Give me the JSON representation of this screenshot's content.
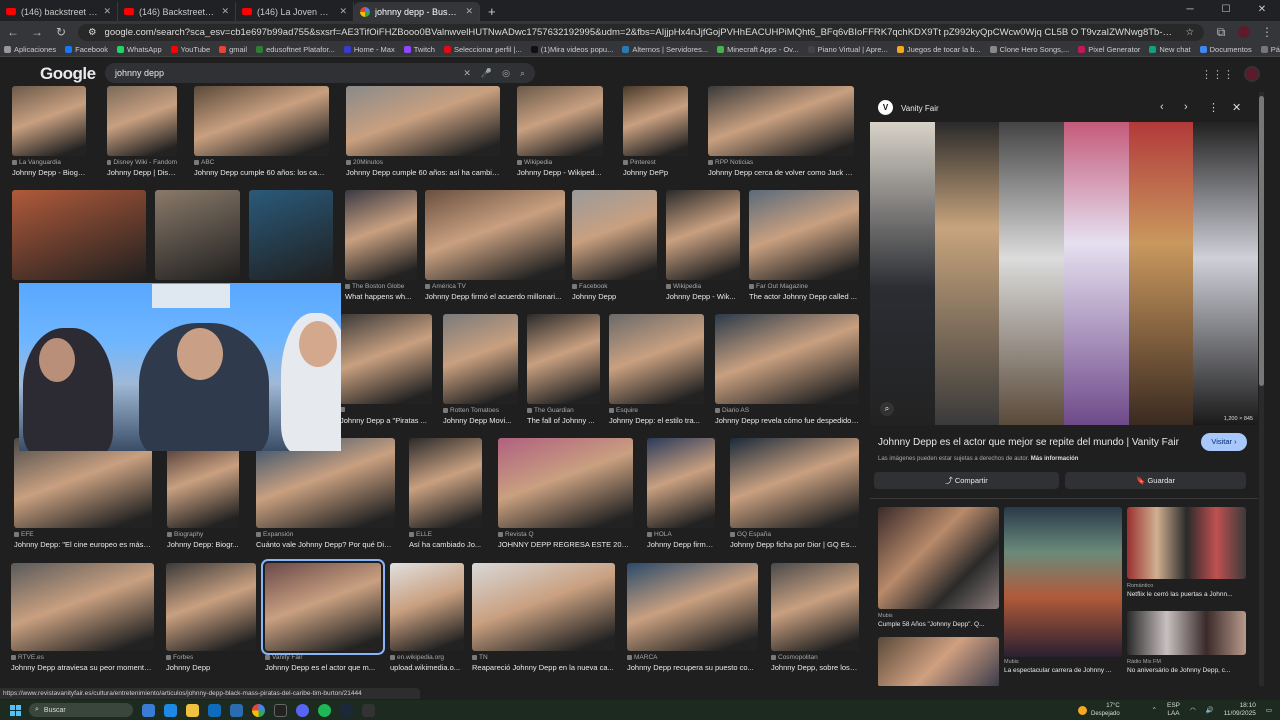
{
  "browser": {
    "tabs": [
      {
        "title": "(146) backstreet boys - YouTube",
        "icon": "youtube-icon",
        "active": false
      },
      {
        "title": "(146) Backstreet Boys - Everybody",
        "icon": "youtube-icon",
        "active": false
      },
      {
        "title": "(146) La Joven Sensacion - Tic T",
        "icon": "youtube-icon",
        "active": false
      },
      {
        "title": "johnny depp - Buscar con Google",
        "icon": "google-icon",
        "active": true
      }
    ],
    "url": "google.com/search?sca_esv=cb1e697b99ad755&sxsrf=AE3TifOiFHZBooo0BValnwvelHUTNwADwc1757632192995&udm=2&fbs=AIjjpHx4nJjfGojPVHhEACUHPiMQht6_BFq6vBIoFFRK7qchKDX9Tt pZ992kyQpCWcw0Wjq CL5B O T9vzaIZWNwg8Tb-QmvZCiEHsytz1lCFiXD45TFwNx93at7LArk6EoetyQxB0XkUZWpIsL6OVYumoXTG9sQsig11Z5fTjkFXeiu6veBlnj",
    "bookmarks": [
      "Aplicaciones",
      "Facebook",
      "WhatsApp",
      "YouTube",
      "gmail",
      "edusoftnet Platafor...",
      "Home - Max",
      "Twitch",
      "Seleccionar perfil |...",
      "(1)Mira videos popu...",
      "Alternos | Servidores...",
      "Minecraft Apps - Ov...",
      "Piano Virtual | Apre...",
      "Juegos de tocar la b...",
      "Clone Hero Songs,...",
      "Pixel Generator",
      "New chat",
      "Documentos",
      "Página de inicio -..."
    ]
  },
  "google": {
    "logo": "Google",
    "query": "johnny depp"
  },
  "results": [
    {
      "src": "La Vanguardia",
      "title": "Johnny Depp - Biogra..."
    },
    {
      "src": "Disney Wiki - Fandom",
      "title": "Johnny Depp | Disne..."
    },
    {
      "src": "ABC",
      "title": "Johnny Depp cumple 60 años: los cambi..."
    },
    {
      "src": "20Minutos",
      "title": "Johnny Depp cumple 60 años: así ha cambiad..."
    },
    {
      "src": "Wikipedia",
      "title": "Johnny Depp - Wikipedia..."
    },
    {
      "src": "Pinterest",
      "title": "Johnny DePp"
    },
    {
      "src": "RPP Noticias",
      "title": "Johnny Depp cerca de volver como Jack Spa..."
    },
    {
      "src": "The Boston Globe",
      "title": "What happens wh..."
    },
    {
      "src": "América TV",
      "title": "Johnny Depp firmó el acuerdo millonari..."
    },
    {
      "src": "Facebook",
      "title": "Johnny Depp"
    },
    {
      "src": "Wikipedia",
      "title": "Johnny Depp - Wik..."
    },
    {
      "src": "Far Out Magazine",
      "title": "The actor Johnny Depp called ..."
    },
    {
      "src": "",
      "title": "Johnny Depp a \"Piratas ..."
    },
    {
      "src": "Rotten Tomatoes",
      "title": "Johnny Depp Movi..."
    },
    {
      "src": "The Guardian",
      "title": "The fall of Johnny ..."
    },
    {
      "src": "Esquire",
      "title": "Johnny Depp: el estilo tra..."
    },
    {
      "src": "Diario AS",
      "title": "Johnny Depp revela cómo fue despedido ..."
    },
    {
      "src": "EFE",
      "title": "Johnny Depp: \"El cine europeo es más cr..."
    },
    {
      "src": "Biography",
      "title": "Johnny Depp: Biogr..."
    },
    {
      "src": "Expansión",
      "title": "Cuánto vale Johnny Depp? Por qué Disn..."
    },
    {
      "src": "ELLE",
      "title": "Así ha cambiado Jo..."
    },
    {
      "src": "Revista Q",
      "title": "JOHNNY DEPP REGRESA ESTE 2025..."
    },
    {
      "src": "HOLA",
      "title": "Johnny Depp firma ..."
    },
    {
      "src": "GQ España",
      "title": "Johnny Depp ficha por Dior | GQ Esp..."
    },
    {
      "src": "RTVE.es",
      "title": "Johnny Depp atraviesa su peor momento..."
    },
    {
      "src": "Forbes",
      "title": "Johnny Depp"
    },
    {
      "src": "Vanity Fair",
      "title": "Johnny Depp es el actor que m..."
    },
    {
      "src": "en.wikipedia.org",
      "title": "upload.wikimedia.o..."
    },
    {
      "src": "TN",
      "title": "Reapareció Johnny Depp en la nueva ca..."
    },
    {
      "src": "MARCA",
      "title": "Johnny Depp recupera su puesto co..."
    },
    {
      "src": "Cosmopolitan",
      "title": "Johnny Depp, sobre los i..."
    }
  ],
  "panel": {
    "site": "Vanity Fair",
    "logo_letter": "V",
    "dimensions": "1,200 × 845",
    "title": "Johnny Depp es el actor que mejor se repite del mundo | Vanity Fair",
    "visit_label": "Visitar ›",
    "note": "Las imágenes pueden estar sujetas a derechos de autor.",
    "note_link": "Más información",
    "share_label": "Compartir",
    "save_label": "Guardar",
    "related": [
      {
        "src": "Mubis",
        "title": "Cumple 58 Años \"Johnny Depp\". Q..."
      },
      {
        "src": "Mubis",
        "title": "La espectacular carrera de Johnny ..."
      },
      {
        "src": "Romántico",
        "title": "Netflix le cerró las puertas a Johnn..."
      },
      {
        "src": "Rádio Mix FM",
        "title": "No aniversário de Johnny Depp, c..."
      }
    ]
  },
  "status_url": "https://www.revistavanityfair.es/cultura/entretenimiento/articulos/johnny-depp-black-mass-piratas-del-caribe-tim-burton/21444",
  "taskbar": {
    "search_label": "Buscar",
    "weather_temp": "17°C",
    "weather_desc": "Despejado",
    "lang_top": "ESP",
    "lang_bottom": "LAA",
    "time": "18:10",
    "date": "11/09/2025"
  }
}
